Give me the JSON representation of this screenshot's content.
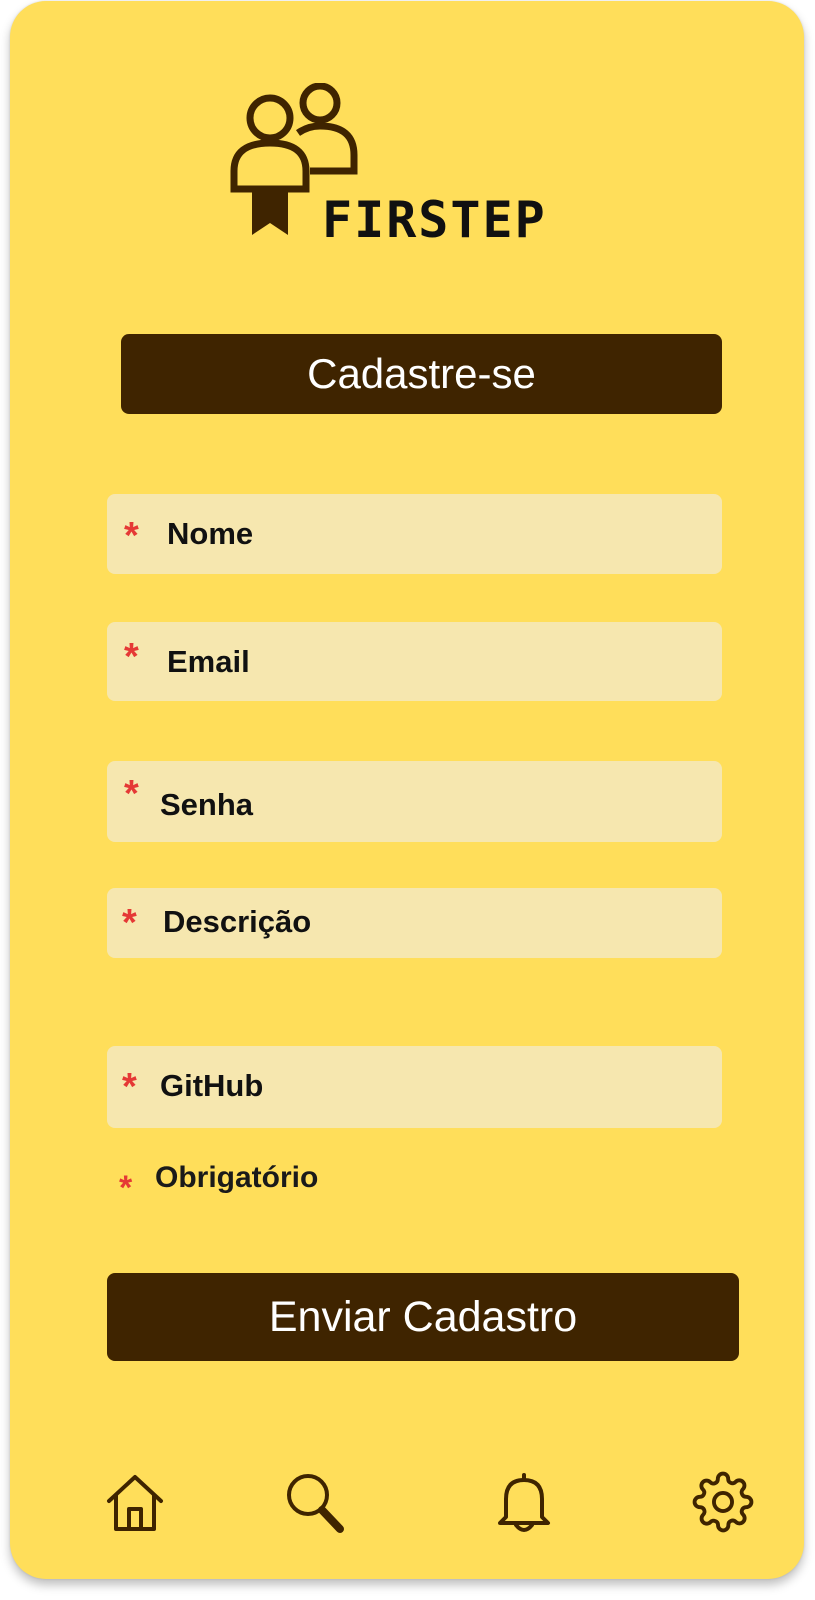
{
  "brand": {
    "name": "FIRSTEP",
    "logo_icon": "users-badge-icon"
  },
  "header": {
    "title": "Cadastre-se"
  },
  "form": {
    "required_marker": "*",
    "fields": [
      {
        "label": "Nome"
      },
      {
        "label": "Email"
      },
      {
        "label": "Senha"
      },
      {
        "label": "Descrição"
      },
      {
        "label": "GitHub"
      }
    ],
    "required_legend": "Obrigatório",
    "submit_label": "Enviar Cadastro"
  },
  "bottom_nav": {
    "items": [
      {
        "icon": "home-icon"
      },
      {
        "icon": "search-icon"
      },
      {
        "icon": "bell-icon"
      },
      {
        "icon": "gear-icon"
      }
    ]
  },
  "colors": {
    "background": "#FFDE5A",
    "primary_dark": "#3F2400",
    "field_background": "#F6E7AF",
    "required_marker": "#E53935"
  }
}
